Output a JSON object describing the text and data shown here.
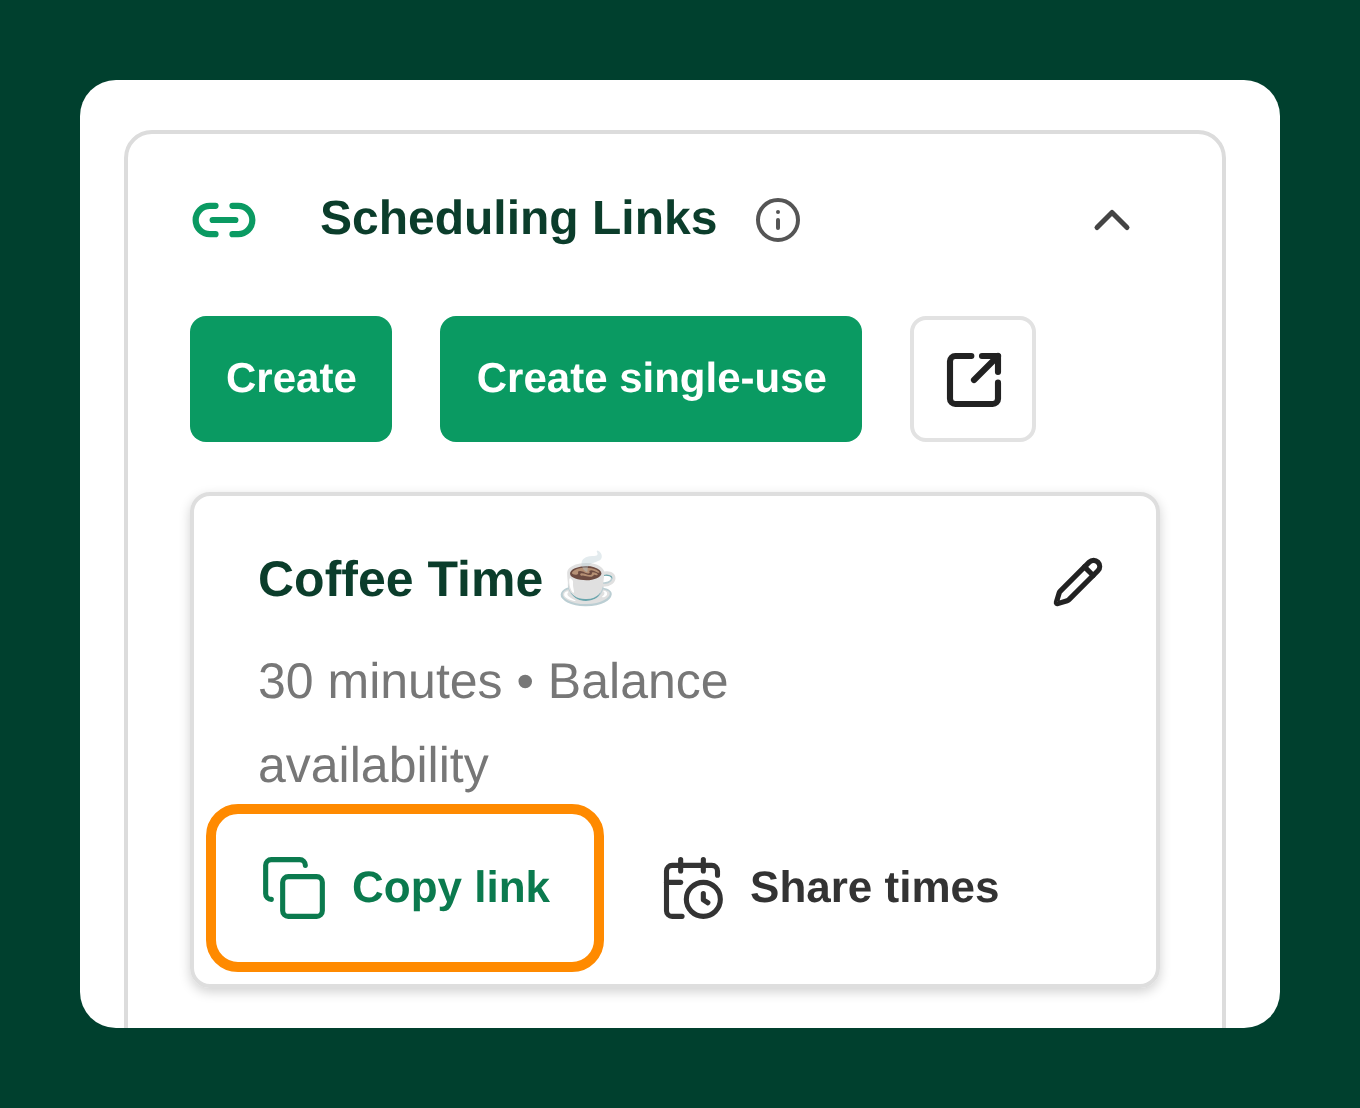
{
  "panel": {
    "title": "Scheduling Links",
    "expanded": true
  },
  "buttons": [
    {
      "label": "Create"
    },
    {
      "label": "Create single-use"
    }
  ],
  "link_card": {
    "title": "Coffee Time ☕",
    "description": "30 minutes • Balance availability",
    "actions": [
      {
        "kind": "copy",
        "label": "Copy link",
        "highlighted": true
      },
      {
        "kind": "share",
        "label": "Share times",
        "highlighted": false
      }
    ]
  }
}
